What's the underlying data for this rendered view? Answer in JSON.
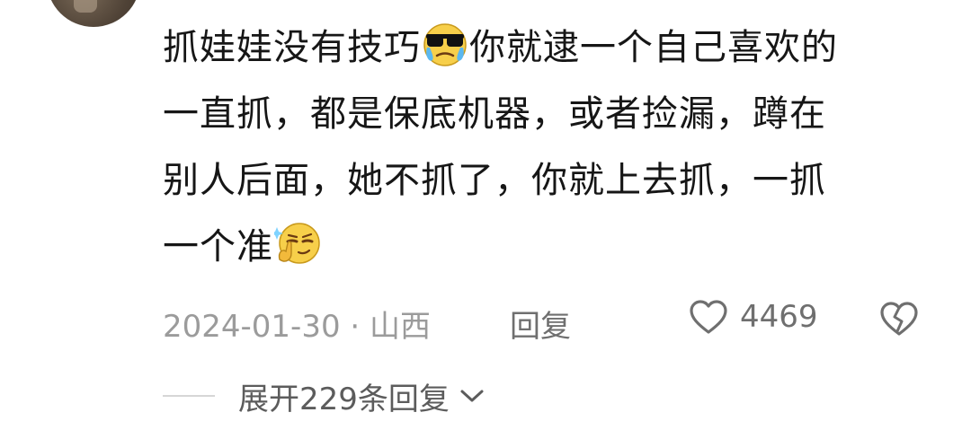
{
  "comment": {
    "segment_1": "抓娃娃没有技巧",
    "emoji_1": "cool-sunglasses-emoji-icon",
    "segment_2": "你就逮一个自己喜欢的",
    "line_2": "一直抓，都是保底机器，或者捡漏，蹲在",
    "line_3": "别人后面，她不抓了，你就上去抓，一抓",
    "line_4": "一个准",
    "emoji_2": "smug-thinking-emoji-icon"
  },
  "meta": {
    "date_location": "2024-01-30 · 山西",
    "reply_label": "回复",
    "like_count": "4469",
    "like_icon": "heart-outline-icon",
    "dislike_icon": "broken-heart-icon"
  },
  "expand": {
    "label": "展开229条回复",
    "icon": "chevron-down-icon"
  },
  "colors": {
    "text": "#161616",
    "meta_text": "#9b9b9b",
    "action_text": "#6f6f6f",
    "background": "#ffffff"
  }
}
